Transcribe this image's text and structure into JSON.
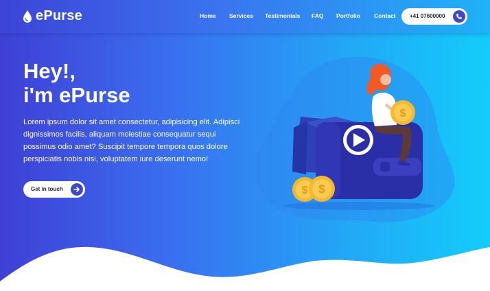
{
  "brand": {
    "name": "ePurse",
    "logo_icon": "drop-icon"
  },
  "nav": {
    "items": [
      {
        "label": "Home"
      },
      {
        "label": "Services"
      },
      {
        "label": "Testimonials"
      },
      {
        "label": "FAQ"
      },
      {
        "label": "Portfolio"
      },
      {
        "label": "Contact"
      }
    ],
    "phone": "+41 07600000",
    "phone_icon": "phone-icon"
  },
  "hero": {
    "headline_line1": "Hey!,",
    "headline_line2": "i'm ePurse",
    "paragraph": "Lorem ipsum dolor sit amet consectetur, adipisicing elit. Adipisci dignissimos facilis, aliquam molestiae consequatur sequi possimus odio amet? Suscipit tempore tempora quos dolore perspiciatis nobis nisi, voluptatem iure deserunt nemo!",
    "cta_label": "Get in touch",
    "cta_icon": "arrow-right-icon",
    "video_icon": "play-icon"
  },
  "colors": {
    "gradient_start": "#3f3fd6",
    "gradient_end": "#12cdfb",
    "accent": "#4047c9",
    "coin": "#f5b82e",
    "hair": "#f15a24"
  }
}
